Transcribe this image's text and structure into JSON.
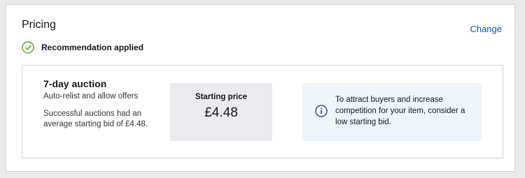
{
  "pricing": {
    "title": "Pricing",
    "change_label": "Change",
    "recommendation_label": "Recommendation applied"
  },
  "format": {
    "title": "7-day auction",
    "subtitle": "Auto-relist and allow offers",
    "note": "Successful auctions had an average starting bid of £4.48."
  },
  "starting_price": {
    "label": "Starting price",
    "value": "£4.48"
  },
  "info": {
    "text": "To attract buyers and increase competition for your item, consider a low starting bid."
  },
  "colors": {
    "link": "#0654ba",
    "success_green": "#5ba71b",
    "info_blue": "#1a3a6b",
    "info_bg": "#eef5fb",
    "price_bg": "#ebebef"
  },
  "icons": {
    "recommendation": "check-circle-icon",
    "info": "info-icon"
  }
}
